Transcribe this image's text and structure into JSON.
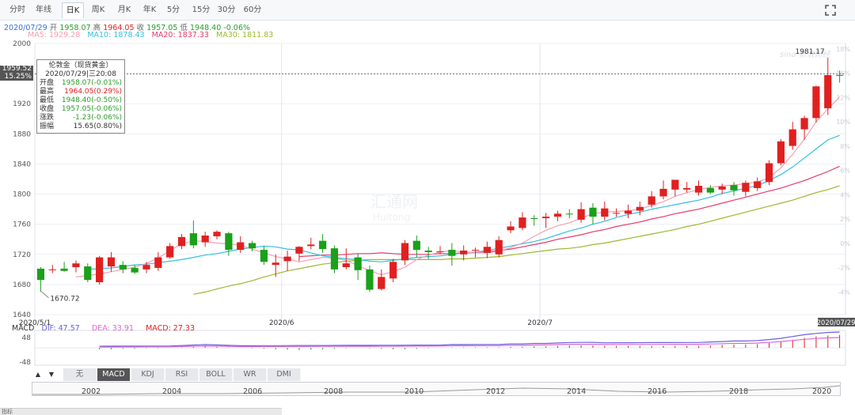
{
  "tabs": [
    {
      "label": "分时",
      "active": false
    },
    {
      "label": "年线",
      "active": false
    },
    {
      "label": "日K",
      "active": true
    },
    {
      "label": "周K",
      "active": false
    },
    {
      "label": "月K",
      "active": false
    },
    {
      "label": "年K",
      "active": false
    },
    {
      "label": "5分",
      "active": false
    },
    {
      "label": "15分",
      "active": false
    },
    {
      "label": "30分",
      "active": false
    },
    {
      "label": "60分",
      "active": false
    }
  ],
  "header": {
    "date": "2020/07/29",
    "open_label": "开",
    "open": "1958.07",
    "high_label": "高",
    "high": "1964.05",
    "close_label": "收",
    "close": "1957.05",
    "low_label": "低",
    "low": "1948.40",
    "change": "-0.06%"
  },
  "ma": {
    "ma5": "MA5: 1929.28",
    "ma10": "MA10: 1878.43",
    "ma20": "MA20: 1837.33",
    "ma30": "MA30: 1811.83"
  },
  "current_price": {
    "price": "1959.52",
    "pct": "15.25%"
  },
  "infobox": {
    "title": "伦敦金（现货黄金）",
    "datetime": "2020/07/29|三20:08",
    "rows": [
      {
        "label": "开盘",
        "value": "1958.07(-0.01%)",
        "color": "#2a9d2a"
      },
      {
        "label": "最高",
        "value": "1964.05(0.29%)",
        "color": "#e02020"
      },
      {
        "label": "最低",
        "value": "1948.40(-0.50%)",
        "color": "#2a9d2a"
      },
      {
        "label": "收盘",
        "value": "1957.05(-0.06%)",
        "color": "#2a9d2a"
      },
      {
        "label": "涨跌",
        "value": "-1.23(-0.06%)",
        "color": "#2a9d2a"
      },
      {
        "label": "振幅",
        "value": "15.65(0.80%)",
        "color": "#333333"
      }
    ]
  },
  "annotations": {
    "max": "1981.17",
    "min": "1670.72",
    "last_date": "2020/07/29"
  },
  "watermark": {
    "logo": "sina 新浪财经",
    "center": "汇通网",
    "center_en": "Huitong"
  },
  "macd": {
    "title": "MACD",
    "dif": "DIF: 47.57",
    "dea": "DEA: 33.91",
    "macd": "MACD: 27.33",
    "ticks": [
      "48",
      "-48"
    ]
  },
  "indicator_tabs": [
    {
      "label": "无",
      "active": false
    },
    {
      "label": "MACD",
      "active": true
    },
    {
      "label": "KDJ",
      "active": false
    },
    {
      "label": "RSI",
      "active": false
    },
    {
      "label": "BOLL",
      "active": false
    },
    {
      "label": "WR",
      "active": false
    },
    {
      "label": "DMI",
      "active": false
    }
  ],
  "nav_years": [
    "2002",
    "2004",
    "2006",
    "2008",
    "2010",
    "2012",
    "2014",
    "2016",
    "2018",
    "2020"
  ],
  "bottom_text": "指标",
  "pct_ticks": [
    "18%",
    "16%",
    "12%",
    "10%",
    "8%",
    "6%",
    "4%",
    "2%",
    "0%",
    "-2%",
    "-4%"
  ],
  "colors": {
    "up": "#e02020",
    "down": "#1aa01a",
    "ma5": "#f5a0b4",
    "ma10": "#36bfe0",
    "ma20": "#e83a6a",
    "ma30": "#9cb830",
    "dif": "#6a5fe0",
    "dea": "#d86ad8"
  },
  "chart_data": {
    "type": "candlestick",
    "title": "伦敦金（现货黄金）日K",
    "ylim": [
      1640,
      2000
    ],
    "yticks": [
      1640,
      1680,
      1720,
      1760,
      1800,
      1840,
      1880,
      1920,
      1960,
      2000
    ],
    "x_labels": [
      {
        "label": "2020/5/1",
        "index": 0
      },
      {
        "label": "2020/6",
        "index": 21
      },
      {
        "label": "2020/7",
        "index": 43
      }
    ],
    "candles": [
      [
        1701,
        1686,
        1703,
        1670
      ],
      [
        1700,
        1700,
        1706,
        1695
      ],
      [
        1701,
        1698,
        1710,
        1697
      ],
      [
        1703,
        1708,
        1712,
        1696
      ],
      [
        1704,
        1686,
        1708,
        1683
      ],
      [
        1683,
        1716,
        1718,
        1680
      ],
      [
        1704,
        1716,
        1723,
        1697
      ],
      [
        1706,
        1700,
        1711,
        1695
      ],
      [
        1702,
        1696,
        1706,
        1694
      ],
      [
        1700,
        1706,
        1710,
        1695
      ],
      [
        1702,
        1716,
        1723,
        1698
      ],
      [
        1716,
        1731,
        1735,
        1714
      ],
      [
        1731,
        1743,
        1747,
        1727
      ],
      [
        1748,
        1732,
        1765,
        1728
      ],
      [
        1736,
        1745,
        1750,
        1730
      ],
      [
        1744,
        1750,
        1752,
        1740
      ],
      [
        1748,
        1726,
        1750,
        1718
      ],
      [
        1726,
        1736,
        1744,
        1722
      ],
      [
        1735,
        1728,
        1738,
        1724
      ],
      [
        1726,
        1710,
        1731,
        1706
      ],
      [
        1706,
        1709,
        1720,
        1690
      ],
      [
        1711,
        1717,
        1725,
        1698
      ],
      [
        1721,
        1730,
        1731,
        1711
      ],
      [
        1731,
        1733,
        1742,
        1727
      ],
      [
        1738,
        1727,
        1747,
        1722
      ],
      [
        1728,
        1700,
        1732,
        1695
      ],
      [
        1703,
        1708,
        1728,
        1700
      ],
      [
        1716,
        1699,
        1721,
        1686
      ],
      [
        1700,
        1673,
        1705,
        1670
      ],
      [
        1674,
        1690,
        1700,
        1672
      ],
      [
        1688,
        1710,
        1714,
        1683
      ],
      [
        1712,
        1735,
        1739,
        1706
      ],
      [
        1738,
        1726,
        1745,
        1716
      ],
      [
        1725,
        1723,
        1730,
        1714
      ],
      [
        1723,
        1724,
        1731,
        1720
      ],
      [
        1726,
        1718,
        1735,
        1705
      ],
      [
        1720,
        1725,
        1732,
        1712
      ],
      [
        1725,
        1726,
        1729,
        1716
      ],
      [
        1722,
        1730,
        1737,
        1715
      ],
      [
        1720,
        1739,
        1744,
        1716
      ],
      [
        1752,
        1757,
        1764,
        1748
      ],
      [
        1755,
        1769,
        1776,
        1752
      ],
      [
        1768,
        1767,
        1772,
        1758
      ],
      [
        1768,
        1770,
        1775,
        1755
      ],
      [
        1770,
        1774,
        1778,
        1764
      ],
      [
        1774,
        1773,
        1780,
        1768
      ],
      [
        1766,
        1780,
        1789,
        1762
      ],
      [
        1782,
        1770,
        1788,
        1760
      ],
      [
        1770,
        1781,
        1790,
        1765
      ],
      [
        1774,
        1775,
        1781,
        1770
      ],
      [
        1774,
        1778,
        1786,
        1768
      ],
      [
        1778,
        1783,
        1790,
        1772
      ],
      [
        1786,
        1797,
        1804,
        1782
      ],
      [
        1797,
        1807,
        1818,
        1793
      ],
      [
        1806,
        1819,
        1818,
        1797
      ],
      [
        1806,
        1808,
        1816,
        1802
      ],
      [
        1802,
        1811,
        1818,
        1798
      ],
      [
        1808,
        1802,
        1812,
        1800
      ],
      [
        1806,
        1810,
        1814,
        1800
      ],
      [
        1812,
        1805,
        1816,
        1798
      ],
      [
        1803,
        1815,
        1818,
        1797
      ],
      [
        1808,
        1817,
        1822,
        1804
      ],
      [
        1816,
        1841,
        1845,
        1812
      ],
      [
        1841,
        1870,
        1873,
        1838
      ],
      [
        1864,
        1886,
        1896,
        1859
      ],
      [
        1886,
        1901,
        1904,
        1872
      ],
      [
        1901,
        1943,
        1944,
        1895
      ],
      [
        1914,
        1958,
        1981,
        1905
      ],
      [
        1958,
        1957,
        1964,
        1948
      ]
    ],
    "ma5": [
      1690,
      1692,
      1694,
      1697,
      1700,
      1703,
      1708,
      1715,
      1725,
      1734,
      1738,
      1737,
      1735,
      1734,
      1732,
      1727,
      1722,
      1717,
      1714,
      1710,
      1713,
      1716,
      1715,
      1712,
      1705,
      1698,
      1693,
      1697,
      1703,
      1713,
      1719,
      1723,
      1725,
      1723,
      1722,
      1722,
      1724,
      1729,
      1735,
      1744,
      1752,
      1758,
      1762,
      1768,
      1774,
      1776,
      1777,
      1778,
      1780,
      1785,
      1790,
      1797,
      1802,
      1806,
      1809,
      1811,
      1812,
      1814,
      1816,
      1822,
      1835,
      1853,
      1873,
      1896,
      1913,
      1929
    ],
    "ma10": [
      1700,
      1701,
      1702,
      1704,
      1706,
      1707,
      1709,
      1711,
      1713,
      1716,
      1719,
      1721,
      1724,
      1727,
      1729,
      1731,
      1730,
      1727,
      1726,
      1722,
      1718,
      1716,
      1714,
      1713,
      1711,
      1710,
      1712,
      1714,
      1716,
      1717,
      1718,
      1720,
      1722,
      1723,
      1725,
      1728,
      1731,
      1734,
      1737,
      1741,
      1746,
      1751,
      1755,
      1760,
      1764,
      1769,
      1773,
      1776,
      1780,
      1783,
      1786,
      1789,
      1792,
      1796,
      1801,
      1804,
      1808,
      1811,
      1818,
      1826,
      1836,
      1848,
      1860,
      1872,
      1878
    ],
    "ma20": [
      1717,
      1718,
      1719,
      1719,
      1720,
      1721,
      1721,
      1722,
      1721,
      1720,
      1720,
      1720,
      1721,
      1721,
      1722,
      1722,
      1723,
      1725,
      1727,
      1730,
      1733,
      1736,
      1740,
      1743,
      1746,
      1750,
      1753,
      1757,
      1760,
      1763,
      1767,
      1770,
      1774,
      1777,
      1780,
      1784,
      1788,
      1792,
      1796,
      1800,
      1804,
      1808,
      1813,
      1818,
      1824,
      1830,
      1837
    ],
    "ma30": [
      1667,
      1670,
      1674,
      1678,
      1681,
      1685,
      1690,
      1694,
      1698,
      1701,
      1704,
      1707,
      1709,
      1711,
      1712,
      1713,
      1713,
      1713,
      1713,
      1713,
      1713,
      1713,
      1714,
      1714,
      1715,
      1716,
      1717,
      1719,
      1721,
      1723,
      1725,
      1727,
      1728,
      1730,
      1733,
      1735,
      1738,
      1741,
      1744,
      1747,
      1750,
      1753,
      1757,
      1760,
      1764,
      1768,
      1772,
      1776,
      1780,
      1784,
      1788,
      1792,
      1797,
      1802,
      1806,
      1811
    ],
    "macd_hist": [
      -3,
      -3,
      -2,
      -2,
      -1,
      -1,
      0,
      1,
      2,
      3,
      2,
      1,
      0,
      -1,
      -2,
      -3,
      -4,
      -5,
      -4,
      -3,
      -2,
      -1,
      0,
      -1,
      -2,
      -3,
      -3,
      -2,
      -1,
      0,
      1,
      1,
      1,
      1,
      1,
      2,
      2,
      3,
      3,
      4,
      5,
      5,
      5,
      4,
      4,
      4,
      4,
      4,
      4,
      4,
      4,
      4,
      5,
      6,
      7,
      7,
      8,
      10,
      13,
      17,
      21,
      24,
      26,
      27
    ]
  }
}
